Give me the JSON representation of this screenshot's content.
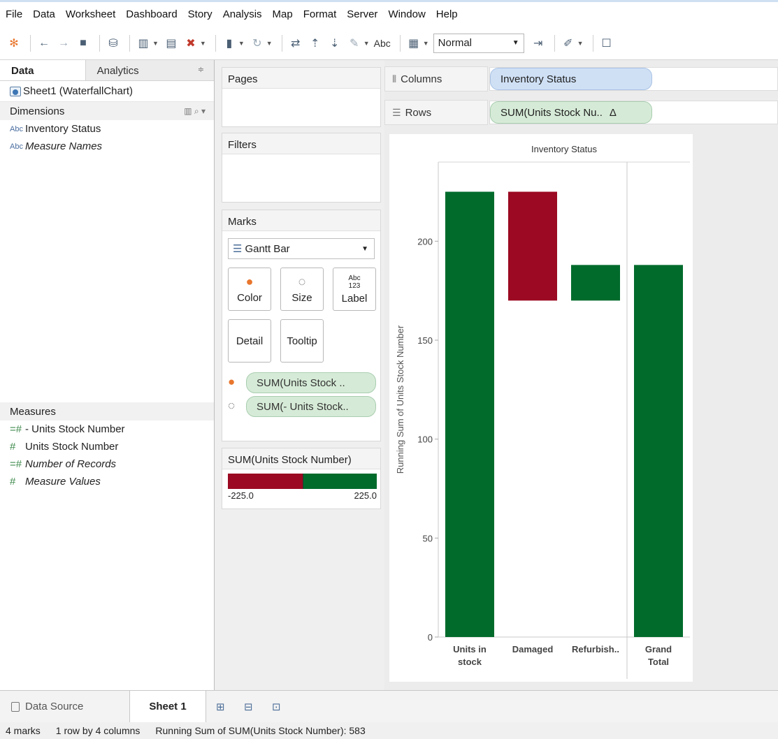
{
  "menu": [
    "File",
    "Data",
    "Worksheet",
    "Dashboard",
    "Story",
    "Analysis",
    "Map",
    "Format",
    "Server",
    "Window",
    "Help"
  ],
  "toolbar": {
    "text_format_label": "Abc",
    "fit_select": "Normal",
    "icons": [
      "tableau-logo-icon",
      "back-arrow-icon",
      "forward-arrow-icon",
      "save-icon",
      "new-datasource-icon",
      "new-worksheet-icon",
      "duplicate-sheet-icon",
      "clear-sheet-icon",
      "pause-updates-icon",
      "refresh-icon",
      "swap-icon",
      "sort-ascending-icon",
      "sort-descending-icon",
      "highlight-icon",
      "show-me-icon",
      "fix-axes-icon",
      "pen-icon",
      "presentation-icon"
    ]
  },
  "data_pane": {
    "tab_data": "Data",
    "tab_analytics": "Analytics",
    "datasource": "Sheet1 (WaterfallChart)",
    "dimensions_header": "Dimensions",
    "dimensions": [
      {
        "type": "Abc",
        "label": "Inventory Status",
        "italic": false
      },
      {
        "type": "Abc",
        "label": "Measure Names",
        "italic": true
      }
    ],
    "measures_header": "Measures",
    "measures": [
      {
        "type": "=#",
        "label": "- Units Stock Number",
        "italic": false
      },
      {
        "type": "#",
        "label": "Units Stock Number",
        "italic": false
      },
      {
        "type": "=#",
        "label": "Number of Records",
        "italic": true
      },
      {
        "type": "#",
        "label": "Measure Values",
        "italic": true
      }
    ]
  },
  "shelves": {
    "pages": "Pages",
    "filters": "Filters",
    "marks": "Marks",
    "mark_type": "Gantt Bar",
    "mark_buttons": {
      "color": "Color",
      "size": "Size",
      "label": "Label",
      "detail": "Detail",
      "tooltip": "Tooltip",
      "label_icon": "Abc 123"
    },
    "marks_pills": [
      "SUM(Units Stock ..",
      "SUM(- Units Stock.."
    ],
    "legend_title": "SUM(Units Stock Number)",
    "legend_min": "-225.0",
    "legend_max": "225.0",
    "legend_colors": {
      "negative": "#9b0a22",
      "positive": "#016b2c"
    }
  },
  "view": {
    "columns_label": "Columns",
    "rows_label": "Rows",
    "columns_pill": "Inventory Status",
    "rows_pill": "SUM(Units Stock Nu..",
    "rows_pill_delta": "Δ"
  },
  "chart_data": {
    "type": "waterfall (gantt bar)",
    "title": "Inventory Status",
    "ylabel": "Running Sum of Units Stock Number",
    "ylim": [
      0,
      240
    ],
    "yticks": [
      0,
      50,
      100,
      150,
      200
    ],
    "categories": [
      "Units in stock",
      "Damaged",
      "Refurbish..",
      "Grand Total"
    ],
    "category_labels": [
      [
        "Units in",
        "stock"
      ],
      [
        "Damaged"
      ],
      [
        "Refurbish.."
      ],
      [
        "Grand",
        "Total"
      ]
    ],
    "bars": [
      {
        "category": "Units in stock",
        "start": 0,
        "end": 225,
        "color": "#016b2c"
      },
      {
        "category": "Damaged",
        "start": 225,
        "end": 170,
        "color": "#9b0a22"
      },
      {
        "category": "Refurbish..",
        "start": 170,
        "end": 188,
        "color": "#016b2c"
      },
      {
        "category": "Grand Total",
        "start": 0,
        "end": 188,
        "color": "#016b2c"
      }
    ],
    "grid": false
  },
  "tabs": {
    "data_source": "Data Source",
    "sheet": "Sheet 1",
    "new_tab_icons": [
      "new-worksheet-tab-icon",
      "new-dashboard-tab-icon",
      "new-story-tab-icon"
    ]
  },
  "status": {
    "marks": "4 marks",
    "layout": "1 row by 4 columns",
    "summary": "Running Sum of SUM(Units Stock Number): 583"
  }
}
